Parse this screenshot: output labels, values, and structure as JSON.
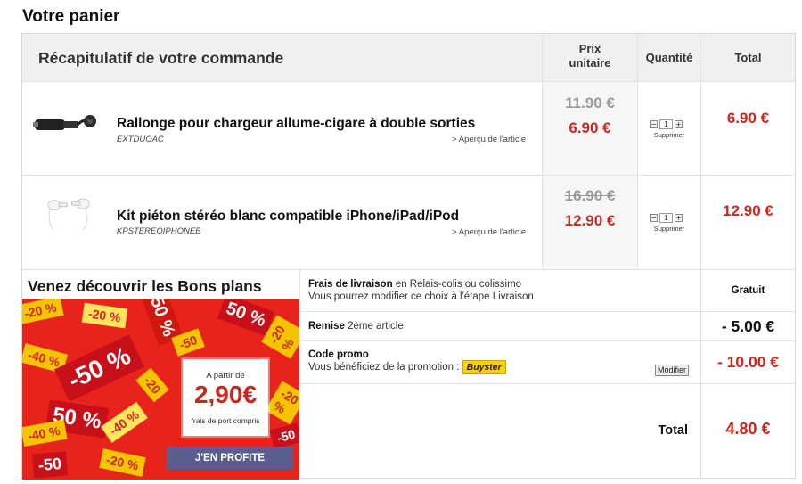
{
  "page": {
    "title": "Votre panier"
  },
  "table": {
    "summary_title": "Récapitulatif de votre commande",
    "col_unit_price": "Prix unitaire",
    "col_quantity": "Quantité",
    "col_total": "Total"
  },
  "items": [
    {
      "image_icon": "car-charger-extension-image",
      "name": "Rallonge pour chargeur allume-cigare à double sorties",
      "ref": "EXTDUOAC",
      "preview_link": "> Aperçu de l'article",
      "old_price": "11.90 €",
      "new_price": "6.90 €",
      "quantity": "1",
      "remove_label": "Supprimer",
      "total": "6.90 €"
    },
    {
      "image_icon": "white-earphones-image",
      "name": "Kit piéton stéréo blanc compatible iPhone/iPad/iPod",
      "ref": "KPSTEREOIPHONEB",
      "preview_link": "> Aperçu de l'article",
      "old_price": "16.90 €",
      "new_price": "12.90 €",
      "quantity": "1",
      "remove_label": "Supprimer",
      "total": "12.90 €"
    }
  ],
  "promo_banner": {
    "title": "Venez découvrir les Bons plans",
    "tags": [
      "-50 %",
      "50 %",
      "-20 %",
      "-40 %",
      "-50",
      "-20",
      "-40 %",
      "-20 %",
      "50 %",
      "-50",
      "-20 %",
      "-40 %"
    ],
    "card_from": "A partir de",
    "card_price": "2,90€",
    "card_shipping": "frais de port compris",
    "button_label": "J'EN PROFITE"
  },
  "summary": {
    "shipping_label": "Frais de livraison",
    "shipping_detail": "en Relais-colis ou colissimo",
    "shipping_note": "Vous pourrez modifier ce choix à l'étape Livraison",
    "shipping_value": "Gratuit",
    "discount_label": "Remise",
    "discount_detail": "2ème article",
    "discount_value": "- 5.00 €",
    "promo_label": "Code promo",
    "promo_detail": "Vous bénéficiez de la promotion :",
    "promo_brand": "Buyster",
    "promo_modify": "Modifier",
    "promo_value": "- 10.00 €",
    "total_label": "Total",
    "total_value": "4.80 €"
  },
  "colors": {
    "price_red": "#c8281f",
    "strike_gray": "#999999",
    "header_bg": "#f0f0f0",
    "button_purple": "#5b5e8d",
    "buyster_yellow": "#ffd000"
  }
}
